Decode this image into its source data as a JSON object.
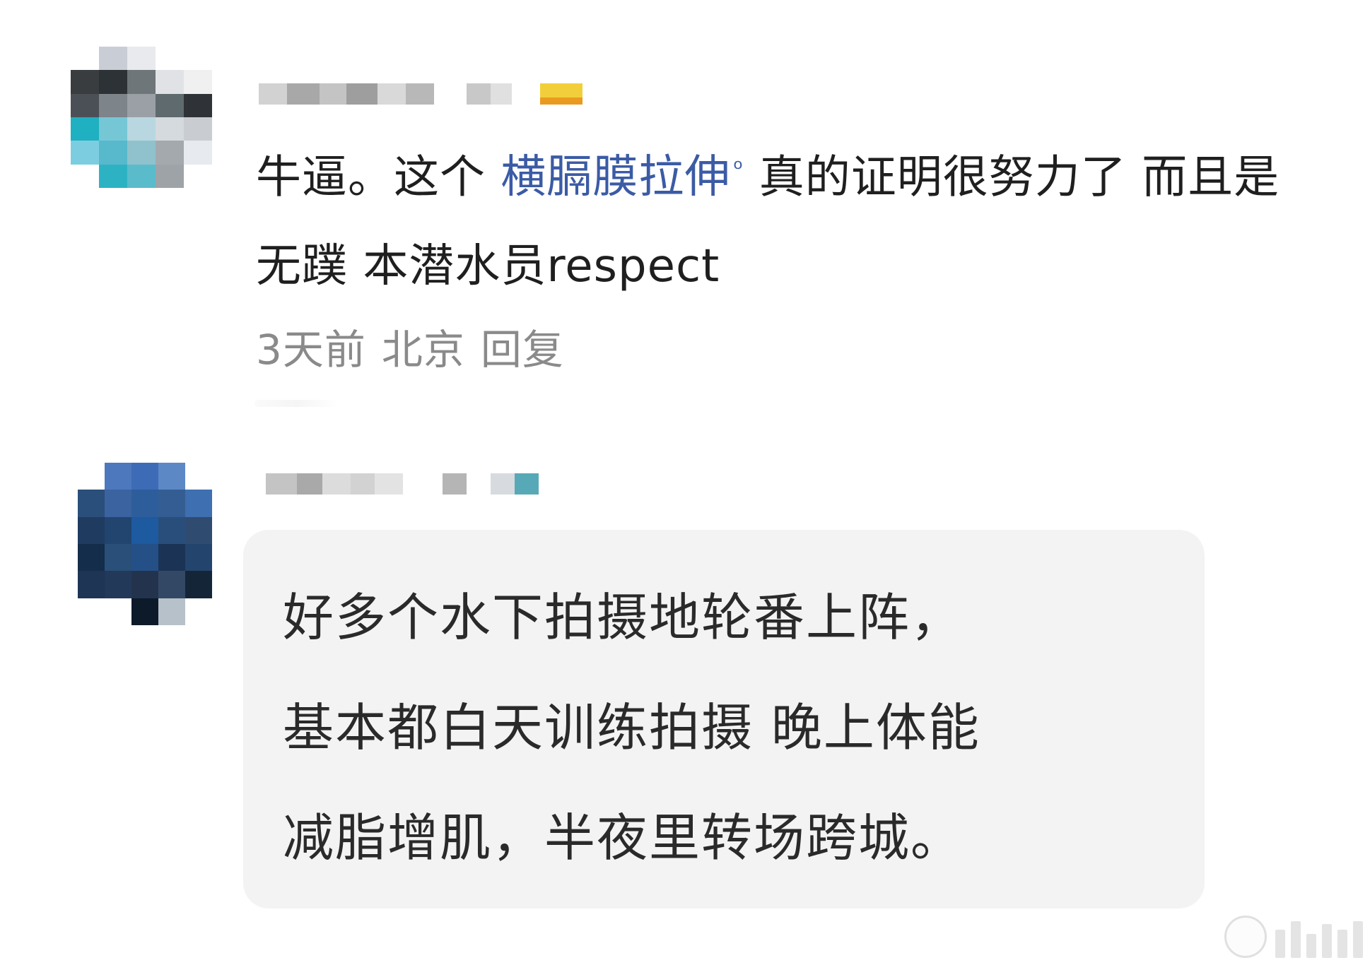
{
  "comment_1": {
    "text_before_link": "牛逼。这个 ",
    "link_text": "横膈膜拉伸",
    "text_after_link": " 真的证明很努力了 而且是无蹼 本潜水员respect",
    "time": "3天前",
    "location": "北京",
    "reply_label": "回复"
  },
  "comment_2": {
    "reply_line_1": "好多个水下拍摄地轮番上阵，",
    "reply_line_2": "基本都白天训练拍摄 晚上体能",
    "reply_line_3": "减脂增肌，半夜里转场跨城。"
  },
  "colors": {
    "link": "#3b5ba5",
    "meta_gray": "#8a8a8a",
    "card_bg": "#f3f3f3"
  }
}
